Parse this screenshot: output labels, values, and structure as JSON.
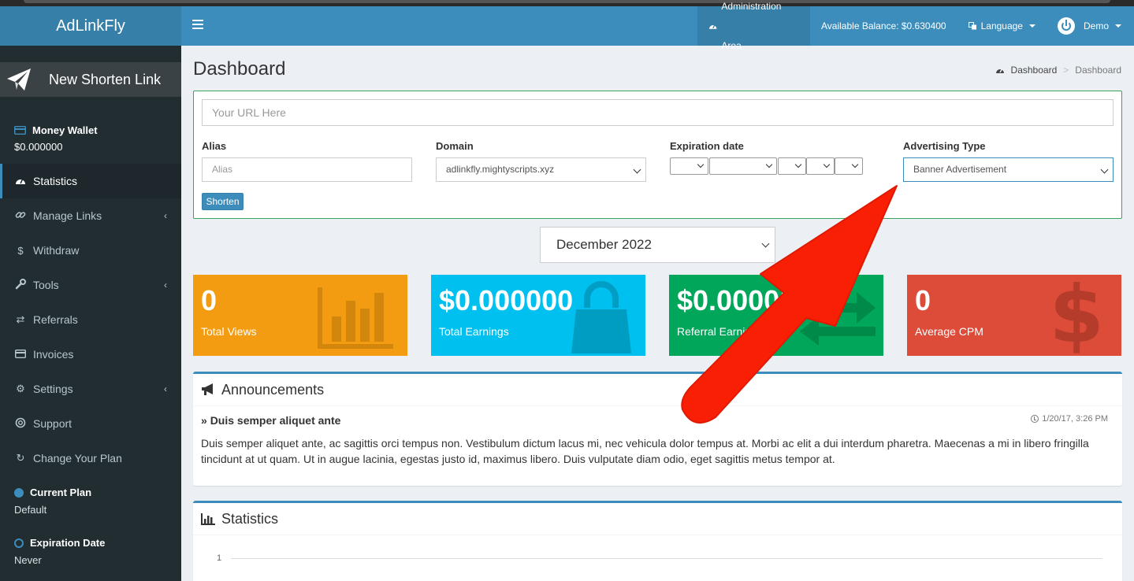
{
  "app": {
    "logo": "AdLinkFly"
  },
  "header": {
    "admin_area": "Administration Area",
    "balance": "Available Balance: $0.630400",
    "language": "Language",
    "user": "Demo"
  },
  "sidebar": {
    "new_link": "New Shorten Link",
    "wallet": {
      "title": "Money Wallet",
      "value": "$0.000000"
    },
    "items": [
      {
        "label": "Statistics",
        "icon": "dashboard-icon",
        "active": true
      },
      {
        "label": "Manage Links",
        "icon": "link-icon",
        "has_children": true
      },
      {
        "label": "Withdraw",
        "icon": "dollar-icon"
      },
      {
        "label": "Tools",
        "icon": "wrench-icon",
        "has_children": true
      },
      {
        "label": "Referrals",
        "icon": "exchange-icon"
      },
      {
        "label": "Invoices",
        "icon": "credit-card-icon"
      },
      {
        "label": "Settings",
        "icon": "gears-icon",
        "has_children": true
      },
      {
        "label": "Support",
        "icon": "life-ring-icon"
      },
      {
        "label": "Change Your Plan",
        "icon": "refresh-icon"
      }
    ],
    "current_plan": {
      "title": "Current Plan",
      "value": "Default"
    },
    "expiration": {
      "title": "Expiration Date",
      "value": "Never"
    }
  },
  "page": {
    "title": "Dashboard",
    "breadcrumb": [
      "Dashboard",
      "Dashboard"
    ]
  },
  "form": {
    "url_placeholder": "Your URL Here",
    "alias_label": "Alias",
    "alias_placeholder": "Alias",
    "domain_label": "Domain",
    "domain_value": "adlinkfly.mightyscripts.xyz",
    "expiration_label": "Expiration date",
    "ad_type_label": "Advertising Type",
    "ad_type_value": "Banner Advertisement",
    "shorten_button": "Shorten"
  },
  "month_select": "December 2022",
  "stats": [
    {
      "value": "0",
      "label": "Total Views",
      "color": "#f39c12",
      "icon": "bar-chart-icon"
    },
    {
      "value": "$0.000000",
      "label": "Total Earnings",
      "color": "#00c0ef",
      "icon": "shopping-bag-icon"
    },
    {
      "value": "$0.000000",
      "label": "Referral Earnings",
      "color": "#00a65a",
      "icon": "exchange-icon"
    },
    {
      "value": "0",
      "label": "Average CPM",
      "color": "#dd4b39",
      "icon": "dollar-icon"
    }
  ],
  "announcements": {
    "heading": "Announcements",
    "title": "Duis semper aliquet ante",
    "time": "1/20/17, 3:26 PM",
    "body": "Duis semper aliquet ante, ac sagittis orci tempus non. Vestibulum dictum lacus mi, nec vehicula dolor tempus at. Morbi ac elit a dui interdum pharetra. Maecenas a mi in libero fringilla tincidunt at ut quam. Ut in augue lacinia, egestas justo id, maximus libero. Duis vulputate diam odio, eget sagittis metus tempor at."
  },
  "statistics_panel": {
    "heading": "Statistics",
    "y_tick": "1"
  },
  "colors": {
    "header": "#3c8dbc",
    "sidebar": "#222d32",
    "annotation_arrow": "#f91f05"
  }
}
